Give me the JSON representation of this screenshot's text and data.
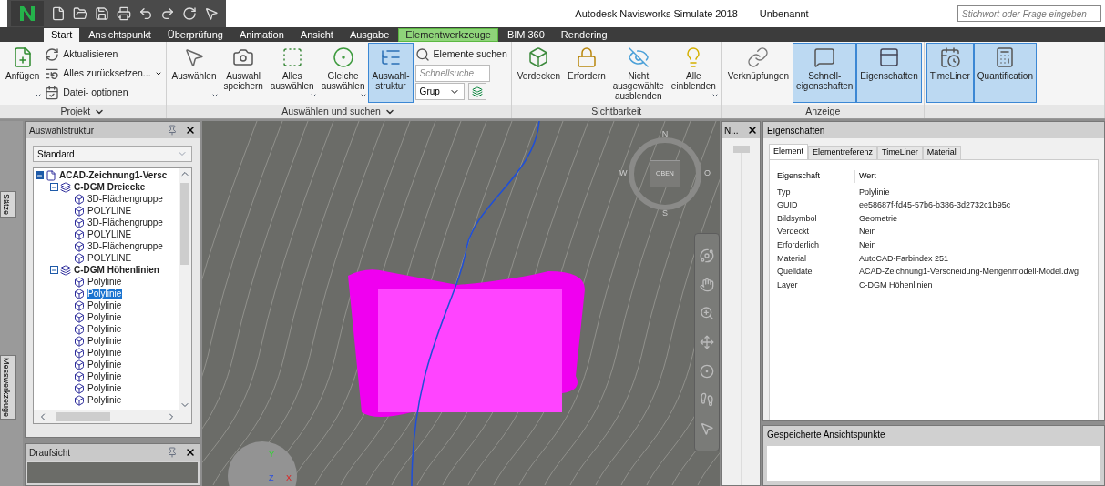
{
  "window": {
    "app_title": "Autodesk Navisworks Simulate 2018",
    "document": "Unbenannt",
    "search": {
      "placeholder": "Stichwort oder Frage eingeben"
    }
  },
  "ribbon_tabs": [
    {
      "label": "Start",
      "selected": true,
      "contextual": false
    },
    {
      "label": "Ansichtspunkt",
      "selected": false,
      "contextual": false
    },
    {
      "label": "Überprüfung",
      "selected": false,
      "contextual": false
    },
    {
      "label": "Animation",
      "selected": false,
      "contextual": false
    },
    {
      "label": "Ansicht",
      "selected": false,
      "contextual": false
    },
    {
      "label": "Ausgabe",
      "selected": false,
      "contextual": false
    },
    {
      "label": "Elementwerkzeuge",
      "selected": false,
      "contextual": true
    },
    {
      "label": "BIM 360",
      "selected": false,
      "contextual": false
    },
    {
      "label": "Rendering",
      "selected": false,
      "contextual": false
    }
  ],
  "ribbon_groups": [
    {
      "label": "Projekt",
      "menu": true,
      "items": [
        {
          "kind": "large",
          "label": "Anfügen",
          "dropdown": true,
          "active": false
        },
        {
          "kind": "stack",
          "items": [
            {
              "kind": "small",
              "label": "Aktualisieren",
              "dropdown": false
            },
            {
              "kind": "small",
              "label": "Alles zurücksetzen...",
              "dropdown": true
            },
            {
              "kind": "small",
              "label": "Datei- optionen",
              "dropdown": false
            }
          ]
        }
      ]
    },
    {
      "label": "Auswählen und suchen",
      "menu": true,
      "items": [
        {
          "kind": "large",
          "label": "Auswählen",
          "dropdown": true,
          "active": false
        },
        {
          "kind": "large",
          "label": "Auswahl speichern",
          "dropdown": false,
          "active": false
        },
        {
          "kind": "large",
          "label": "Alles auswählen",
          "dropdown": true,
          "active": false
        },
        {
          "kind": "large",
          "label": "Gleiche auswählen",
          "dropdown": true,
          "active": false
        },
        {
          "kind": "large",
          "label": "Auswahl-struktur",
          "dropdown": false,
          "active": true
        },
        {
          "kind": "stack",
          "items": [
            {
              "kind": "small",
              "label": "Elemente suchen",
              "dropdown": false
            },
            {
              "kind": "search",
              "placeholder": "Schnellsuche"
            },
            {
              "kind": "combo",
              "value": "Grup"
            }
          ]
        }
      ]
    },
    {
      "label": "Sichtbarkeit",
      "menu": false,
      "items": [
        {
          "kind": "large",
          "label": "Verdecken",
          "dropdown": false,
          "active": false
        },
        {
          "kind": "large",
          "label": "Erfordern",
          "dropdown": false,
          "active": false
        },
        {
          "kind": "large",
          "label": "Nicht ausgewählte ausblenden",
          "dropdown": false,
          "active": false
        },
        {
          "kind": "large",
          "label": "Alle einblenden",
          "dropdown": true,
          "active": false
        }
      ]
    },
    {
      "label": "Anzeige",
      "menu": false,
      "items": [
        {
          "kind": "large",
          "label": "Verknüpfungen",
          "dropdown": false,
          "active": false
        },
        {
          "kind": "large",
          "label": "Schnell-eigenschaften",
          "dropdown": false,
          "active": true
        },
        {
          "kind": "large",
          "label": "Eigenschaften",
          "dropdown": false,
          "active": true
        }
      ]
    },
    {
      "menu": false,
      "items": [
        {
          "kind": "large",
          "label": "TimeLiner",
          "dropdown": false,
          "active": true
        },
        {
          "kind": "large",
          "label": "Quantification",
          "dropdown": false,
          "active": true
        }
      ]
    }
  ],
  "side_tabs": [
    "Sätze",
    "Messwerkzeuge"
  ],
  "selection_tree": {
    "title": "Auswahlstruktur",
    "mode": "Standard",
    "nodes": [
      {
        "label": "ACAD-Zeichnung1-Versc",
        "kind": "file",
        "expanded": true,
        "selected": false,
        "children": [
          {
            "label": "C-DGM Dreiecke",
            "kind": "layer",
            "expanded": true,
            "selected": false,
            "children": [
              {
                "label": "3D-Flächengruppe",
                "kind": "item",
                "selected": false
              },
              {
                "label": "POLYLINE",
                "kind": "item",
                "selected": false
              },
              {
                "label": "3D-Flächengruppe",
                "kind": "item",
                "selected": false
              },
              {
                "label": "POLYLINE",
                "kind": "item",
                "selected": false
              },
              {
                "label": "3D-Flächengruppe",
                "kind": "item",
                "selected": false
              },
              {
                "label": "POLYLINE",
                "kind": "item",
                "selected": false
              }
            ]
          },
          {
            "label": "C-DGM Höhenlinien",
            "kind": "layer",
            "expanded": true,
            "selected": false,
            "children": [
              {
                "label": "Polylinie",
                "kind": "item",
                "selected": false
              },
              {
                "label": "Polylinie",
                "kind": "item",
                "selected": true
              },
              {
                "label": "Polylinie",
                "kind": "item",
                "selected": false
              },
              {
                "label": "Polylinie",
                "kind": "item",
                "selected": false
              },
              {
                "label": "Polylinie",
                "kind": "item",
                "selected": false
              },
              {
                "label": "Polylinie",
                "kind": "item",
                "selected": false
              },
              {
                "label": "Polylinie",
                "kind": "item",
                "selected": false
              },
              {
                "label": "Polylinie",
                "kind": "item",
                "selected": false
              },
              {
                "label": "Polylinie",
                "kind": "item",
                "selected": false
              },
              {
                "label": "Polylinie",
                "kind": "item",
                "selected": false
              },
              {
                "label": "Polylinie",
                "kind": "item",
                "selected": false
              }
            ]
          }
        ]
      }
    ]
  },
  "plan_view": {
    "title": "Draufsicht"
  },
  "viewport": {
    "view_cube": {
      "face": "OBEN",
      "north": "N",
      "south": "S",
      "west": "W",
      "east": "O"
    },
    "axes": {
      "y": "Y",
      "z": "Z",
      "x": "X"
    }
  },
  "narrow_panel": {
    "title": "N..."
  },
  "properties": {
    "title": "Eigenschaften",
    "tabs": [
      {
        "label": "Element",
        "selected": true
      },
      {
        "label": "Elementreferenz",
        "selected": false
      },
      {
        "label": "TimeLiner",
        "selected": false
      },
      {
        "label": "Material",
        "selected": false
      }
    ],
    "columns": [
      "Eigenschaft",
      "Wert"
    ],
    "rows": [
      [
        "Typ",
        "Polylinie"
      ],
      [
        "GUID",
        "ee58687f-fd45-57b6-b386-3d2732c1b95c"
      ],
      [
        "Bildsymbol",
        "Geometrie"
      ],
      [
        "Verdeckt",
        "Nein"
      ],
      [
        "Erforderlich",
        "Nein"
      ],
      [
        "Material",
        "AutoCAD-Farbindex 251"
      ],
      [
        "Quelldatei",
        "ACAD-Zeichnung1-Verscneidung-Mengenmodell-Model.dwg"
      ],
      [
        "Layer",
        "C-DGM Höhenlinien"
      ]
    ]
  },
  "saved_viewpoints": {
    "title": "Gespeicherte Ansichtspunkte"
  }
}
